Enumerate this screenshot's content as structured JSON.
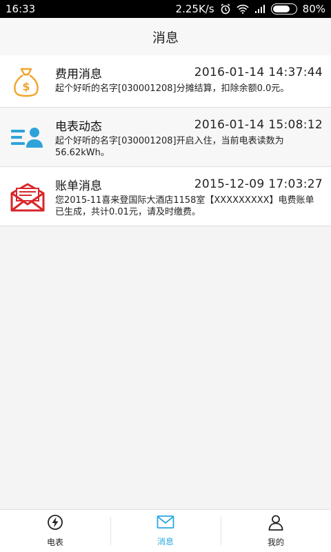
{
  "status": {
    "time": "16:33",
    "speed": "2.25K/s",
    "battery": "80%",
    "battery_level": 0.8
  },
  "header": {
    "title": "消息"
  },
  "messages": [
    {
      "title": "费用消息",
      "time": "2016-01-14 14:37:44",
      "body": "起个好听的名字[030001208]分摊结算，扣除余额0.0元。",
      "icon": "money-bag-icon",
      "color": "#f0a42b"
    },
    {
      "title": "电表动态",
      "time": "2016-01-14 15:08:12",
      "body": "起个好听的名字[030001208]开启入住，当前电表读数为56.62kWh。",
      "icon": "user-list-icon",
      "color": "#2fa3d9"
    },
    {
      "title": "账单消息",
      "time": "2015-12-09 17:03:27",
      "body": "您2015-11喜来登国际大酒店1158室【XXXXXXXXX】电费账单已生成，共计0.01元，请及时缴费。",
      "icon": "envelope-icon",
      "color": "#d8262a"
    }
  ],
  "tabs": [
    {
      "label": "电表",
      "icon": "lightning-icon"
    },
    {
      "label": "消息",
      "icon": "mail-icon",
      "active": true
    },
    {
      "label": "我的",
      "icon": "person-icon"
    }
  ],
  "colors": {
    "accent": "#29a8e0"
  }
}
